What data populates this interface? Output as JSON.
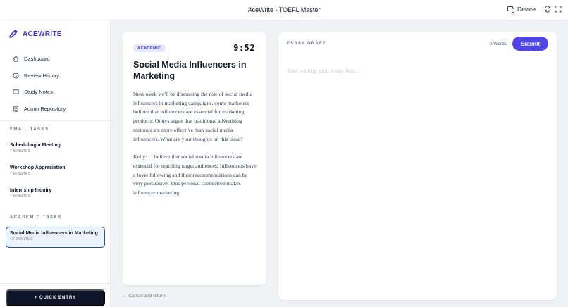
{
  "window": {
    "title": "AceWrite - TOEFL Master",
    "device_label": "Device"
  },
  "brand": {
    "name": "ACEWRITE",
    "accent": "#4338ca"
  },
  "nav": [
    {
      "label": "Dashboard",
      "icon": "home-icon"
    },
    {
      "label": "Review History",
      "icon": "clock-icon"
    },
    {
      "label": "Study Notes",
      "icon": "book-icon"
    },
    {
      "label": "Admin Repository",
      "icon": "building-icon"
    }
  ],
  "sections": {
    "email": "EMAIL TASKS",
    "academic": "ACADEMIC TASKS"
  },
  "email_tasks": [
    {
      "title": "Scheduling a Meeting",
      "duration": "7 MINUTES"
    },
    {
      "title": "Workshop Appreciation",
      "duration": "7 MINUTES"
    },
    {
      "title": "Internship Inquiry",
      "duration": "7 MINUTES"
    }
  ],
  "academic_tasks": [
    {
      "title": "Social Media Influencers in Marketing",
      "duration": "10 MINUTES",
      "active": true
    }
  ],
  "quick_entry": "+ QUICK ENTRY",
  "prompt": {
    "badge": "ACADEMIC",
    "timer": "9:52",
    "title": "Social Media Influencers in Marketing",
    "paragraph1": "Next week we'll be discussing the role of social media influencers in marketing campaigns. some marketers believe that influencers are essential for marketing products. Others argue that traditional advertising methods are more effective than social media influencers. What are your thoughts on this issue?",
    "paragraph2": "Kelly:   I believe that social media influencers are essential for reaching target audiences, Influencers have a loyal following and their recommendations can be very persuasive. This personal connection makes influencer marketing"
  },
  "cancel": "Cancel and return",
  "essay": {
    "label": "ESSAY DRAFT",
    "word_count": "0 Words",
    "submit": "Submit",
    "placeholder": "Start writing your essay here...",
    "value": ""
  }
}
